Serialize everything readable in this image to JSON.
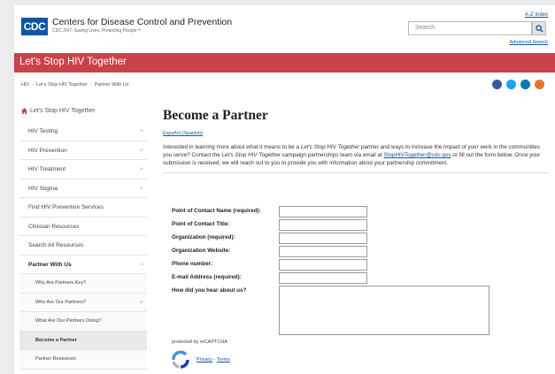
{
  "header": {
    "logo": "CDC",
    "org_name": "Centers for Disease Control and Prevention",
    "tagline": "CDC 24/7: Saving Lives, Protecting People™",
    "az_index": "A-Z Index",
    "search_placeholder": "Search",
    "advanced_search": "Advanced Search"
  },
  "banner": {
    "title": "Let's Stop HIV Together"
  },
  "breadcrumb": [
    "HIV",
    "Let's Stop HIV Together",
    "Partner With Us"
  ],
  "social": [
    {
      "icon": "facebook-icon",
      "color": "#3b5998"
    },
    {
      "icon": "twitter-icon",
      "color": "#1da1f2"
    },
    {
      "icon": "linkedin-icon",
      "color": "#0e76a8"
    },
    {
      "icon": "syndicate-icon",
      "color": "#e8742d"
    }
  ],
  "sidebar": {
    "home_label": "Let's Stop HIV Together",
    "items": [
      {
        "label": "HIV Testing",
        "plus": "+"
      },
      {
        "label": "HIV Prevention",
        "plus": "+"
      },
      {
        "label": "HIV Treatment",
        "plus": "+"
      },
      {
        "label": "HIV Stigma",
        "plus": "+"
      },
      {
        "label": "Find HIV Prevention Services",
        "plus": ""
      },
      {
        "label": "Clinician Resources",
        "plus": ""
      },
      {
        "label": "Search All Resources",
        "plus": ""
      },
      {
        "label": "Partner With Us",
        "plus": "–"
      },
      {
        "label": "Why Are Partners Key?",
        "plus": ""
      },
      {
        "label": "Who Are Our Partners?",
        "plus": "+"
      },
      {
        "label": "What Are Our Partners Doing?",
        "plus": ""
      },
      {
        "label": "Become a Partner",
        "plus": ""
      },
      {
        "label": "Partner Resources",
        "plus": ""
      }
    ]
  },
  "main": {
    "title": "Become a Partner",
    "espanol": "Español (Spanish)",
    "intro_1": "Interested in learning more about what it means to be a ",
    "intro_em1": "Let's Stop HIV Together",
    "intro_2": " partner and ways to increase the impact of your work in the communities you serve? Contact the ",
    "intro_em2": "Let's Stop HIV Together",
    "intro_3": " campaign partnerships team via email at ",
    "intro_email": "StopHIVTogether@cdc.gov",
    "intro_4": " or fill out the form below. Once your submission is received, we will reach out to you to provide you with information about your partnership commitment."
  },
  "form": {
    "fields": [
      {
        "label": "Point of Contact Name (required):"
      },
      {
        "label": "Point of Contact Title:"
      },
      {
        "label": "Organization (required):"
      },
      {
        "label": "Organization Website:"
      },
      {
        "label": "Phone number:"
      },
      {
        "label": "E-mail Address (required):"
      }
    ],
    "textarea_label": "How did you hear about us?",
    "recaptcha_label": "protected by reCAPTCHA",
    "privacy": "Privacy",
    "terms": "Terms"
  }
}
